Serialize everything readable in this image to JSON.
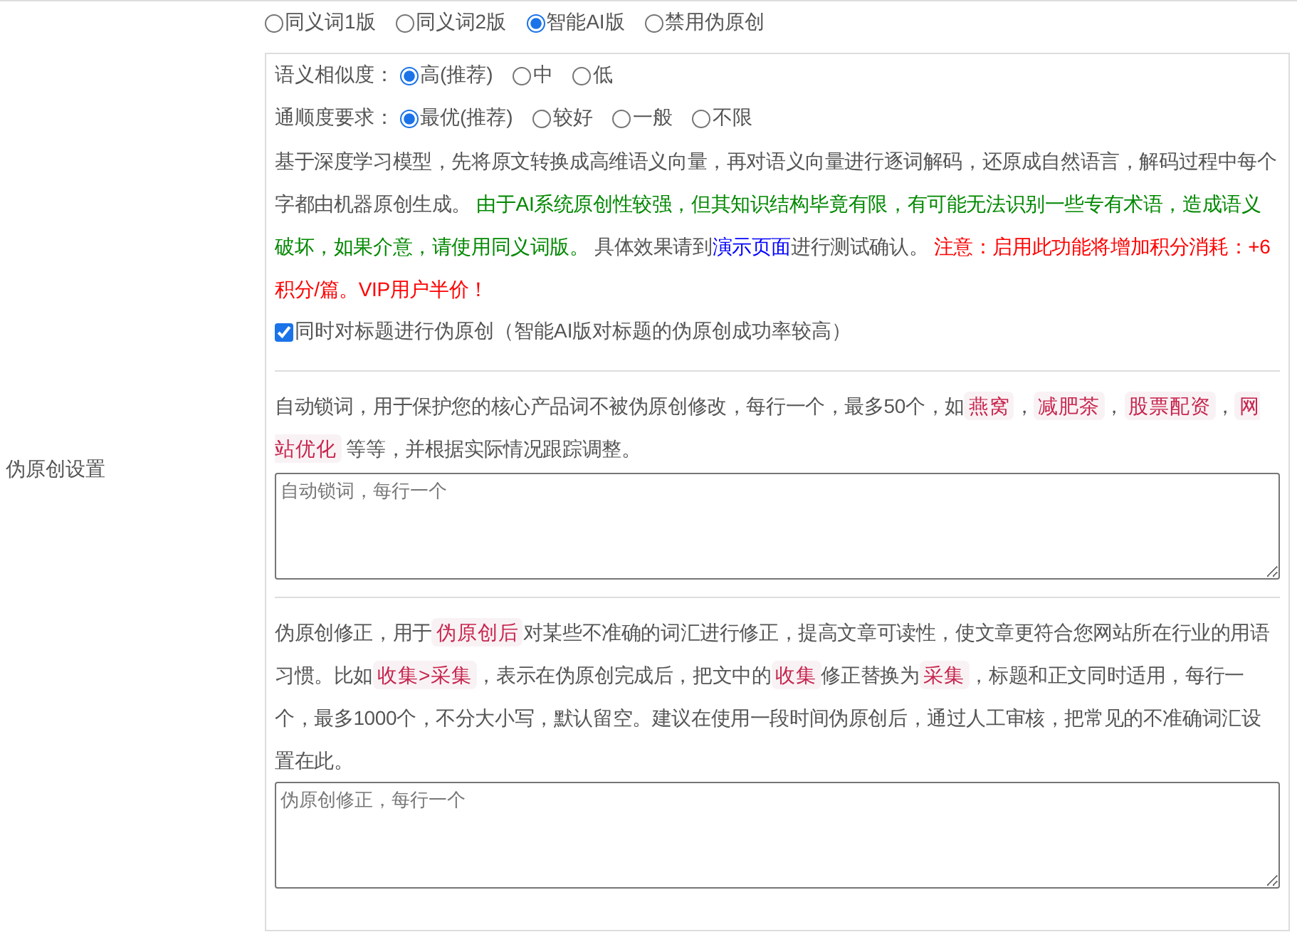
{
  "section_label": "伪原创设置",
  "modes": [
    {
      "label": "同义词1版",
      "selected": false
    },
    {
      "label": "同义词2版",
      "selected": false
    },
    {
      "label": "智能AI版",
      "selected": true
    },
    {
      "label": "禁用伪原创",
      "selected": false
    }
  ],
  "similarity": {
    "label": "语义相似度：",
    "options": [
      {
        "label": "高(推荐)",
        "selected": true
      },
      {
        "label": "中",
        "selected": false
      },
      {
        "label": "低",
        "selected": false
      }
    ]
  },
  "fluency": {
    "label": "通顺度要求：",
    "options": [
      {
        "label": "最优(推荐)",
        "selected": true
      },
      {
        "label": "较好",
        "selected": false
      },
      {
        "label": "一般",
        "selected": false
      },
      {
        "label": "不限",
        "selected": false
      }
    ]
  },
  "description": [
    {
      "kind": "plain",
      "text": "基于深度学习模型，先将原文转换成高维语义向量，再对语义向量进行逐词解码，还原成自然语言，解码过程中每个字都由机器原创生成。 "
    },
    {
      "kind": "success",
      "text": "由于AI系统原创性较强，但其知识结构毕竟有限，有可能无法识别一些专有术语，造成语义破坏，如果介意，请使用同义词版。"
    },
    {
      "kind": "plain",
      "text": " 具体效果请到"
    },
    {
      "kind": "link",
      "text": "演示页面"
    },
    {
      "kind": "plain",
      "text": "进行测试确认。 "
    },
    {
      "kind": "warning",
      "text": "注意：启用此功能将增加积分消耗：+6积分/篇。VIP用户半价！"
    }
  ],
  "title_option": {
    "label": "同时对标题进行伪原创（智能AI版对标题的伪原创成功率较高）",
    "checked": true
  },
  "lock_words": {
    "description": [
      {
        "kind": "plain",
        "text": "自动锁词，用于保护您的核心产品词不被伪原创修改，每行一个，最多50个，如"
      },
      {
        "kind": "code",
        "text": "燕窝"
      },
      {
        "kind": "plain",
        "text": "，"
      },
      {
        "kind": "code",
        "text": "减肥茶"
      },
      {
        "kind": "plain",
        "text": "，"
      },
      {
        "kind": "code",
        "text": "股票配资"
      },
      {
        "kind": "plain",
        "text": "，"
      },
      {
        "kind": "code",
        "text": "网站优化"
      },
      {
        "kind": "plain",
        "text": " 等等，并根据实际情况跟踪调整。"
      }
    ],
    "placeholder": "自动锁词，每行一个"
  },
  "corrections": {
    "description": [
      {
        "kind": "plain",
        "text": "伪原创修正，用于"
      },
      {
        "kind": "code",
        "text": "伪原创后"
      },
      {
        "kind": "plain",
        "text": "对某些不准确的词汇进行修正，提高文章可读性，使文章更符合您网站所在行业的用语习惯。比如"
      },
      {
        "kind": "code",
        "text": "收集>采集"
      },
      {
        "kind": "plain",
        "text": "，表示在伪原创完成后，把文中的"
      },
      {
        "kind": "code",
        "text": "收集"
      },
      {
        "kind": "plain",
        "text": "修正替换为"
      },
      {
        "kind": "code",
        "text": "采集"
      },
      {
        "kind": "plain",
        "text": "，标题和正文同时适用，每行一个，最多1000个，不分大小写，默认留空。建议在使用一段时间伪原创后，通过人工审核，把常见的不准确词汇设置在此。"
      }
    ],
    "placeholder": "伪原创修正，每行一个"
  }
}
